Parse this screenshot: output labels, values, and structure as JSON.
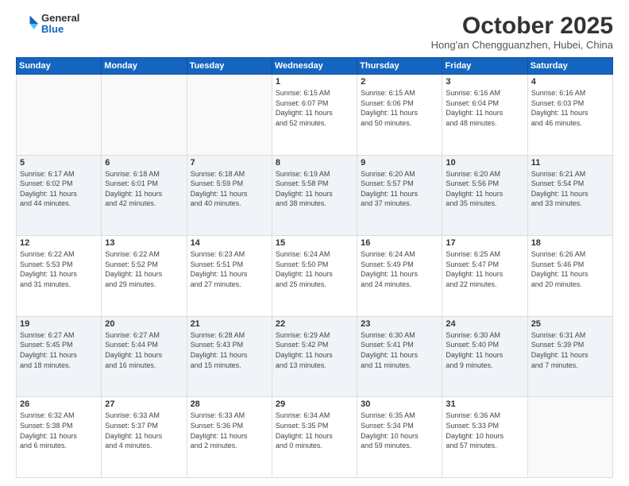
{
  "header": {
    "logo": {
      "general": "General",
      "blue": "Blue"
    },
    "title": "October 2025",
    "location": "Hong'an Chengguanzhen, Hubei, China"
  },
  "weekdays": [
    "Sunday",
    "Monday",
    "Tuesday",
    "Wednesday",
    "Thursday",
    "Friday",
    "Saturday"
  ],
  "weeks": [
    [
      {
        "day": "",
        "info": ""
      },
      {
        "day": "",
        "info": ""
      },
      {
        "day": "",
        "info": ""
      },
      {
        "day": "1",
        "info": "Sunrise: 6:15 AM\nSunset: 6:07 PM\nDaylight: 11 hours\nand 52 minutes."
      },
      {
        "day": "2",
        "info": "Sunrise: 6:15 AM\nSunset: 6:06 PM\nDaylight: 11 hours\nand 50 minutes."
      },
      {
        "day": "3",
        "info": "Sunrise: 6:16 AM\nSunset: 6:04 PM\nDaylight: 11 hours\nand 48 minutes."
      },
      {
        "day": "4",
        "info": "Sunrise: 6:16 AM\nSunset: 6:03 PM\nDaylight: 11 hours\nand 46 minutes."
      }
    ],
    [
      {
        "day": "5",
        "info": "Sunrise: 6:17 AM\nSunset: 6:02 PM\nDaylight: 11 hours\nand 44 minutes."
      },
      {
        "day": "6",
        "info": "Sunrise: 6:18 AM\nSunset: 6:01 PM\nDaylight: 11 hours\nand 42 minutes."
      },
      {
        "day": "7",
        "info": "Sunrise: 6:18 AM\nSunset: 5:59 PM\nDaylight: 11 hours\nand 40 minutes."
      },
      {
        "day": "8",
        "info": "Sunrise: 6:19 AM\nSunset: 5:58 PM\nDaylight: 11 hours\nand 38 minutes."
      },
      {
        "day": "9",
        "info": "Sunrise: 6:20 AM\nSunset: 5:57 PM\nDaylight: 11 hours\nand 37 minutes."
      },
      {
        "day": "10",
        "info": "Sunrise: 6:20 AM\nSunset: 5:56 PM\nDaylight: 11 hours\nand 35 minutes."
      },
      {
        "day": "11",
        "info": "Sunrise: 6:21 AM\nSunset: 5:54 PM\nDaylight: 11 hours\nand 33 minutes."
      }
    ],
    [
      {
        "day": "12",
        "info": "Sunrise: 6:22 AM\nSunset: 5:53 PM\nDaylight: 11 hours\nand 31 minutes."
      },
      {
        "day": "13",
        "info": "Sunrise: 6:22 AM\nSunset: 5:52 PM\nDaylight: 11 hours\nand 29 minutes."
      },
      {
        "day": "14",
        "info": "Sunrise: 6:23 AM\nSunset: 5:51 PM\nDaylight: 11 hours\nand 27 minutes."
      },
      {
        "day": "15",
        "info": "Sunrise: 6:24 AM\nSunset: 5:50 PM\nDaylight: 11 hours\nand 25 minutes."
      },
      {
        "day": "16",
        "info": "Sunrise: 6:24 AM\nSunset: 5:49 PM\nDaylight: 11 hours\nand 24 minutes."
      },
      {
        "day": "17",
        "info": "Sunrise: 6:25 AM\nSunset: 5:47 PM\nDaylight: 11 hours\nand 22 minutes."
      },
      {
        "day": "18",
        "info": "Sunrise: 6:26 AM\nSunset: 5:46 PM\nDaylight: 11 hours\nand 20 minutes."
      }
    ],
    [
      {
        "day": "19",
        "info": "Sunrise: 6:27 AM\nSunset: 5:45 PM\nDaylight: 11 hours\nand 18 minutes."
      },
      {
        "day": "20",
        "info": "Sunrise: 6:27 AM\nSunset: 5:44 PM\nDaylight: 11 hours\nand 16 minutes."
      },
      {
        "day": "21",
        "info": "Sunrise: 6:28 AM\nSunset: 5:43 PM\nDaylight: 11 hours\nand 15 minutes."
      },
      {
        "day": "22",
        "info": "Sunrise: 6:29 AM\nSunset: 5:42 PM\nDaylight: 11 hours\nand 13 minutes."
      },
      {
        "day": "23",
        "info": "Sunrise: 6:30 AM\nSunset: 5:41 PM\nDaylight: 11 hours\nand 11 minutes."
      },
      {
        "day": "24",
        "info": "Sunrise: 6:30 AM\nSunset: 5:40 PM\nDaylight: 11 hours\nand 9 minutes."
      },
      {
        "day": "25",
        "info": "Sunrise: 6:31 AM\nSunset: 5:39 PM\nDaylight: 11 hours\nand 7 minutes."
      }
    ],
    [
      {
        "day": "26",
        "info": "Sunrise: 6:32 AM\nSunset: 5:38 PM\nDaylight: 11 hours\nand 6 minutes."
      },
      {
        "day": "27",
        "info": "Sunrise: 6:33 AM\nSunset: 5:37 PM\nDaylight: 11 hours\nand 4 minutes."
      },
      {
        "day": "28",
        "info": "Sunrise: 6:33 AM\nSunset: 5:36 PM\nDaylight: 11 hours\nand 2 minutes."
      },
      {
        "day": "29",
        "info": "Sunrise: 6:34 AM\nSunset: 5:35 PM\nDaylight: 11 hours\nand 0 minutes."
      },
      {
        "day": "30",
        "info": "Sunrise: 6:35 AM\nSunset: 5:34 PM\nDaylight: 10 hours\nand 59 minutes."
      },
      {
        "day": "31",
        "info": "Sunrise: 6:36 AM\nSunset: 5:33 PM\nDaylight: 10 hours\nand 57 minutes."
      },
      {
        "day": "",
        "info": ""
      }
    ]
  ]
}
